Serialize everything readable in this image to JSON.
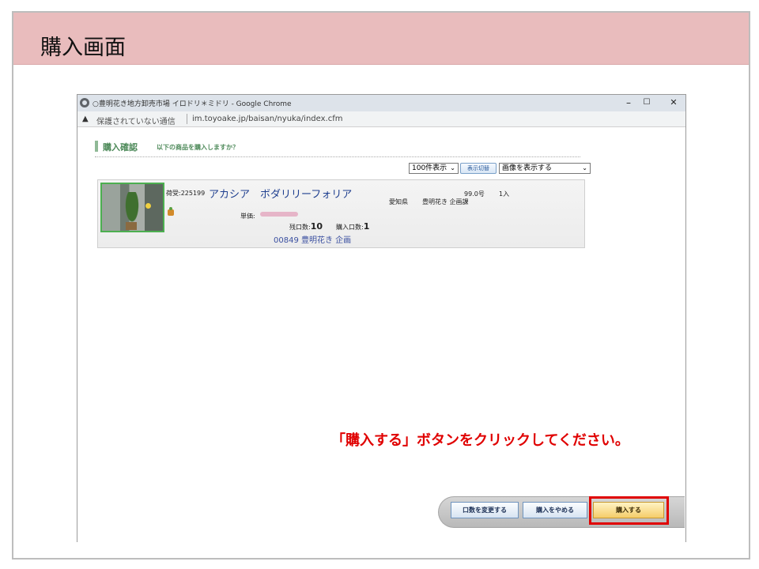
{
  "slide": {
    "title": "購入画面"
  },
  "browser": {
    "window_title": "○豊明花き地方卸売市場 イロドリ＊ミドリ - Google Chrome",
    "controls": {
      "minimize": "–",
      "maximize": "☐",
      "close": "✕"
    },
    "address": {
      "security_label": "保護されていない通信",
      "url": "im.toyoake.jp/baisan/nyuka/index.cfm"
    }
  },
  "page": {
    "confirm_title": "購入確認",
    "confirm_subtitle": "以下の商品を購入しますか？",
    "toolbar": {
      "per_page_select": "100件表示",
      "switch_button": "表示切替",
      "image_select": "画像を表示する"
    },
    "item": {
      "ship_label": "荷受:225199",
      "name": "アカシア　ボダリリーフォリア",
      "size": "99.0号",
      "qty": "1入",
      "region": "愛知県",
      "shipper": "豊明花き 企画課",
      "price_label": "単価:",
      "remaining_label": "残口数:",
      "remaining_value": "10",
      "buy_label": "購入口数:",
      "buy_value": "1",
      "seller": "00849 豊明花き 企画"
    },
    "annotation": "「購入する」ボタンをクリックしてください。",
    "buttons": {
      "change_qty": "口数を変更する",
      "cancel": "購入をやめる",
      "purchase": "購入する"
    }
  },
  "colors": {
    "header_bg": "#e9bcbd",
    "annotation": "#e00000",
    "highlight_border": "#e00000",
    "accent_green": "#4e8a5a"
  },
  "icons": [
    "chrome-icon",
    "warning-icon",
    "item-category-icon"
  ]
}
